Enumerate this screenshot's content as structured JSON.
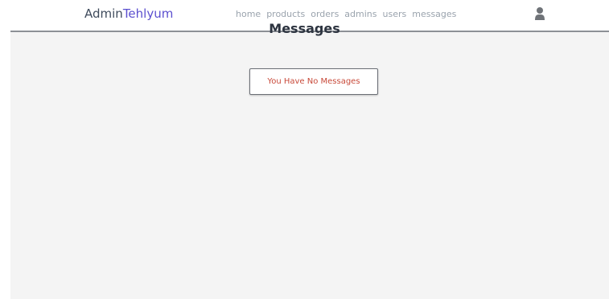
{
  "header": {
    "logo_prefix": "Admin",
    "logo_brand": "Tehlyum",
    "nav": {
      "home": "home",
      "products": "products",
      "orders": "orders",
      "admins": "admins",
      "users": "users",
      "messages": "messages"
    },
    "user_icon": "user-icon"
  },
  "main": {
    "title": "Messages",
    "empty_message": "You Have No Messages"
  },
  "colors": {
    "brand": "#5b4fcf",
    "empty_text": "#c84a3a",
    "background": "#f4f4f4"
  }
}
